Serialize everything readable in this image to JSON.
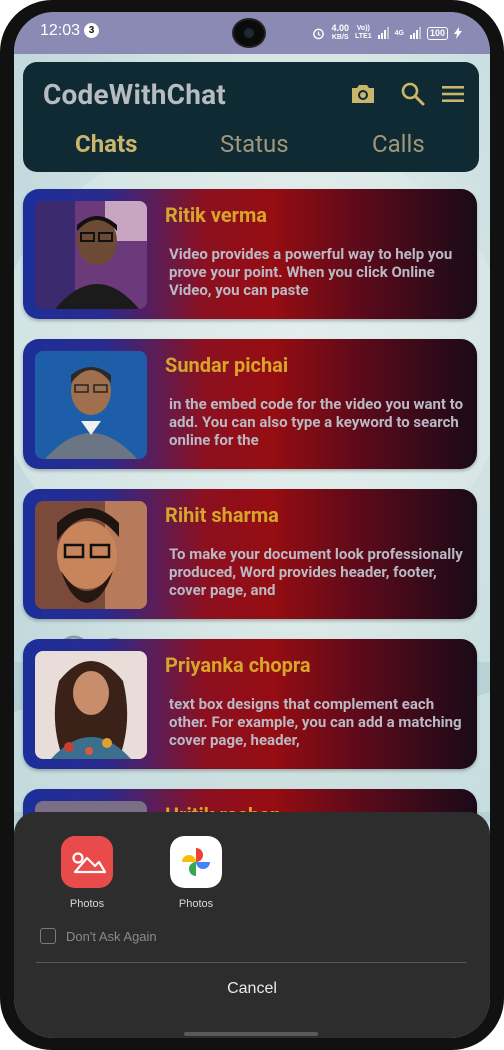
{
  "status": {
    "time": "12:03",
    "notif_count": "3",
    "net_speed_top": "4.00",
    "net_speed_bottom": "KB/S",
    "volte_top": "Vo))",
    "volte_bottom": "LTE1",
    "network": "4G",
    "battery": "100"
  },
  "appbar": {
    "title": "CodeWithChat",
    "tabs": [
      "Chats",
      "Status",
      "Calls"
    ]
  },
  "chats": [
    {
      "name": "Ritik verma",
      "message": "Video provides a powerful way to help you prove your point. When you click Online Video, you can paste"
    },
    {
      "name": "Sundar pichai",
      "message": "in the embed code for the video you want to add. You can also type a keyword to search online for the"
    },
    {
      "name": "Rihit sharma",
      "message": "To make your document look professionally produced, Word provides header, footer, cover page, and"
    },
    {
      "name": "Priyanka chopra",
      "message": "text box designs that complement each other. For example, you can add a matching cover page, header,"
    },
    {
      "name": "Hritik roshan",
      "message": ""
    }
  ],
  "sheet": {
    "apps": [
      {
        "label": "Photos",
        "icon": "gallery-photos-icon"
      },
      {
        "label": "Photos",
        "icon": "google-photos-icon"
      }
    ],
    "dont_ask": "Don't Ask Again",
    "cancel": "Cancel"
  },
  "colors": {
    "appbar_bg": "#0f2a33",
    "tab_active": "#c9b66c",
    "name_color": "#d6a62a",
    "sheet_bg": "#2d2d2d"
  }
}
